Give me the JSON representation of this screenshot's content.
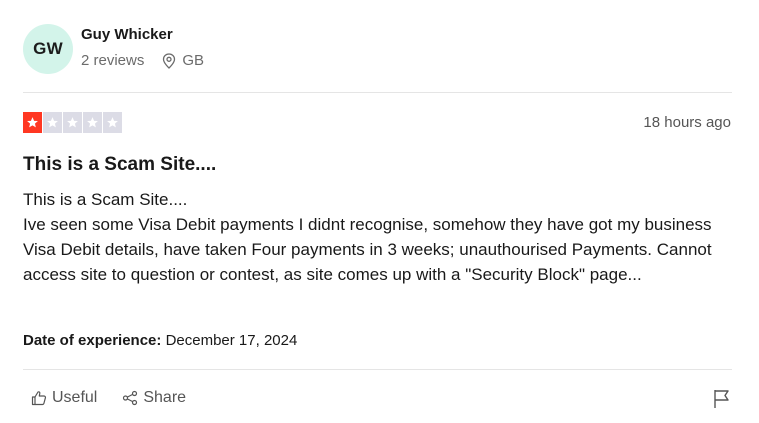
{
  "reviewer": {
    "initials": "GW",
    "name": "Guy Whicker",
    "review_count": "2 reviews",
    "location": "GB"
  },
  "review": {
    "rating": 1,
    "max_rating": 5,
    "time": "18 hours ago",
    "title": "This is a Scam Site....",
    "body": "This is a Scam Site....\nIve seen some Visa Debit payments I didnt recognise, somehow they have got my business Visa Debit details, have taken Four payments in 3 weeks; unauthourised Payments. Cannot access site to question or contest, as site comes up with a \"Security Block\" page...",
    "experience_label": "Date of experience:",
    "experience_date": "December 17, 2024"
  },
  "actions": {
    "useful_label": "Useful",
    "share_label": "Share"
  },
  "icons": {
    "location": "map-pin-icon",
    "useful": "thumbs-up-icon",
    "share": "share-icon",
    "report": "flag-icon",
    "star": "star-icon"
  },
  "colors": {
    "avatar_bg": "#d3f4ea",
    "star_filled": "#ff3722",
    "star_empty": "#dcdce6",
    "muted_text": "#6b6b6b"
  }
}
